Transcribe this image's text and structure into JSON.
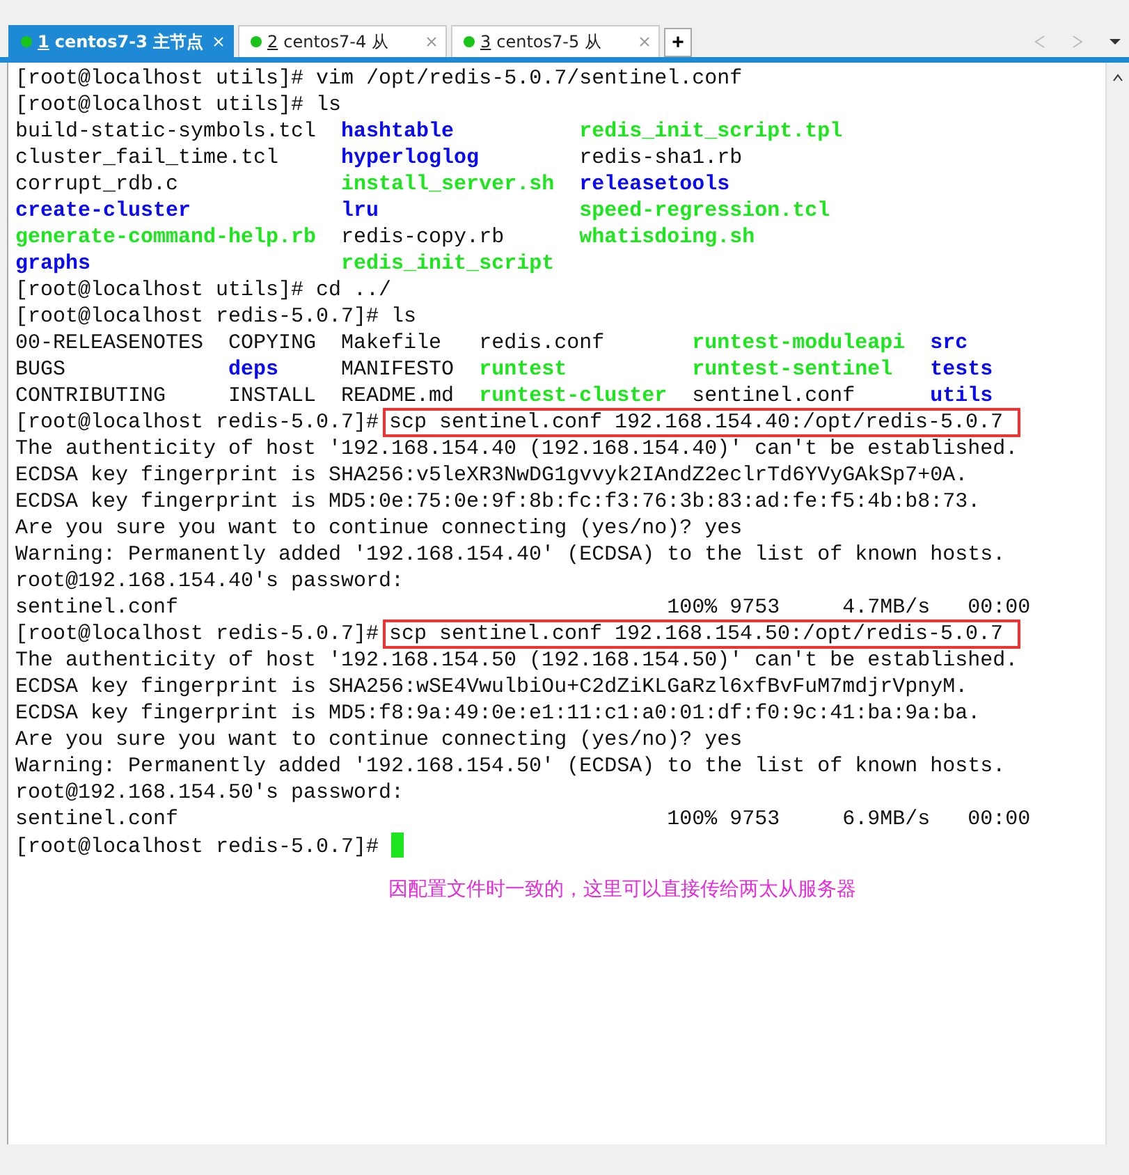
{
  "tabs": [
    {
      "number": "1",
      "title": "centos7-3 主节点",
      "selected": true
    },
    {
      "number": "2",
      "title": "centos7-4 从",
      "selected": false
    },
    {
      "number": "3",
      "title": "centos7-5 从",
      "selected": false
    }
  ],
  "new_tab": "+",
  "terminal": {
    "lines": [
      {
        "kind": "command",
        "prompt": "[root@localhost utils]#",
        "command": "vim /opt/redis-5.0.7/sentinel.conf",
        "highlighted": false
      },
      {
        "kind": "command",
        "prompt": "[root@localhost utils]#",
        "command": "ls",
        "highlighted": false
      },
      {
        "kind": "listing",
        "rows": [
          [
            {
              "text": "build-static-symbols.tcl",
              "kind": "file"
            },
            {
              "text": "hashtable",
              "kind": "dir"
            },
            {
              "text": "redis_init_script.tpl",
              "kind": "exec"
            }
          ],
          [
            {
              "text": "cluster_fail_time.tcl",
              "kind": "file"
            },
            {
              "text": "hyperloglog",
              "kind": "dir"
            },
            {
              "text": "redis-sha1.rb",
              "kind": "file"
            }
          ],
          [
            {
              "text": "corrupt_rdb.c",
              "kind": "file"
            },
            {
              "text": "install_server.sh",
              "kind": "exec"
            },
            {
              "text": "releasetools",
              "kind": "dir"
            }
          ],
          [
            {
              "text": "create-cluster",
              "kind": "dir"
            },
            {
              "text": "lru",
              "kind": "dir"
            },
            {
              "text": "speed-regression.tcl",
              "kind": "exec"
            }
          ],
          [
            {
              "text": "generate-command-help.rb",
              "kind": "exec"
            },
            {
              "text": "redis-copy.rb",
              "kind": "file"
            },
            {
              "text": "whatisdoing.sh",
              "kind": "exec"
            }
          ],
          [
            {
              "text": "graphs",
              "kind": "dir"
            },
            {
              "text": "redis_init_script",
              "kind": "exec"
            }
          ]
        ]
      },
      {
        "kind": "command",
        "prompt": "[root@localhost utils]#",
        "command": "cd ../",
        "highlighted": false
      },
      {
        "kind": "command",
        "prompt": "[root@localhost redis-5.0.7]#",
        "command": "ls",
        "highlighted": false
      },
      {
        "kind": "listing",
        "rows": [
          [
            {
              "text": "00-RELEASENOTES",
              "kind": "file"
            },
            {
              "text": "COPYING",
              "kind": "file"
            },
            {
              "text": "Makefile",
              "kind": "file"
            },
            {
              "text": "redis.conf",
              "kind": "file"
            },
            {
              "text": "runtest-moduleapi",
              "kind": "exec"
            },
            {
              "text": "src",
              "kind": "dir"
            }
          ],
          [
            {
              "text": "BUGS",
              "kind": "file"
            },
            {
              "text": "deps",
              "kind": "dir"
            },
            {
              "text": "MANIFESTO",
              "kind": "file"
            },
            {
              "text": "runtest",
              "kind": "exec"
            },
            {
              "text": "runtest-sentinel",
              "kind": "exec"
            },
            {
              "text": "tests",
              "kind": "dir"
            }
          ],
          [
            {
              "text": "CONTRIBUTING",
              "kind": "file"
            },
            {
              "text": "INSTALL",
              "kind": "file"
            },
            {
              "text": "README.md",
              "kind": "file"
            },
            {
              "text": "runtest-cluster",
              "kind": "exec"
            },
            {
              "text": "sentinel.conf",
              "kind": "file"
            },
            {
              "text": "utils",
              "kind": "dir"
            }
          ]
        ]
      },
      {
        "kind": "command",
        "prompt": "[root@localhost redis-5.0.7]#",
        "command": "scp sentinel.conf 192.168.154.40:/opt/redis-5.0.7",
        "highlighted": true
      },
      {
        "kind": "text",
        "text": "The authenticity of host '192.168.154.40 (192.168.154.40)' can't be established."
      },
      {
        "kind": "text",
        "text": "ECDSA key fingerprint is SHA256:v5leXR3NwDG1gvvyk2IAndZ2eclrTd6YVyGAkSp7+0A."
      },
      {
        "kind": "text",
        "text": "ECDSA key fingerprint is MD5:0e:75:0e:9f:8b:fc:f3:76:3b:83:ad:fe:f5:4b:b8:73."
      },
      {
        "kind": "text",
        "text": "Are you sure you want to continue connecting (yes/no)? yes"
      },
      {
        "kind": "text",
        "text": "Warning: Permanently added '192.168.154.40' (ECDSA) to the list of known hosts."
      },
      {
        "kind": "text",
        "text": "root@192.168.154.40's password:"
      },
      {
        "kind": "text",
        "text": "sentinel.conf                                       100% 9753     4.7MB/s   00:00"
      },
      {
        "kind": "command",
        "prompt": "[root@localhost redis-5.0.7]#",
        "command": "scp sentinel.conf 192.168.154.50:/opt/redis-5.0.7",
        "highlighted": true
      },
      {
        "kind": "text",
        "text": "The authenticity of host '192.168.154.50 (192.168.154.50)' can't be established."
      },
      {
        "kind": "text",
        "text": "ECDSA key fingerprint is SHA256:wSE4VwulbiOu+C2dZiKLGaRzl6xfBvFuM7mdjrVpnyM."
      },
      {
        "kind": "text",
        "text": "ECDSA key fingerprint is MD5:f8:9a:49:0e:e1:11:c1:a0:01:df:f0:9c:41:ba:9a:ba."
      },
      {
        "kind": "text",
        "text": "Are you sure you want to continue connecting (yes/no)? yes"
      },
      {
        "kind": "text",
        "text": "Warning: Permanently added '192.168.154.50' (ECDSA) to the list of known hosts."
      },
      {
        "kind": "text",
        "text": "root@192.168.154.50's password:"
      },
      {
        "kind": "text",
        "text": "sentinel.conf                                       100% 9753     6.9MB/s   00:00"
      },
      {
        "kind": "cursor",
        "prompt": "[root@localhost redis-5.0.7]#"
      }
    ],
    "annotation": "因配置文件时一致的，这里可以直接传给两太从服务器"
  }
}
